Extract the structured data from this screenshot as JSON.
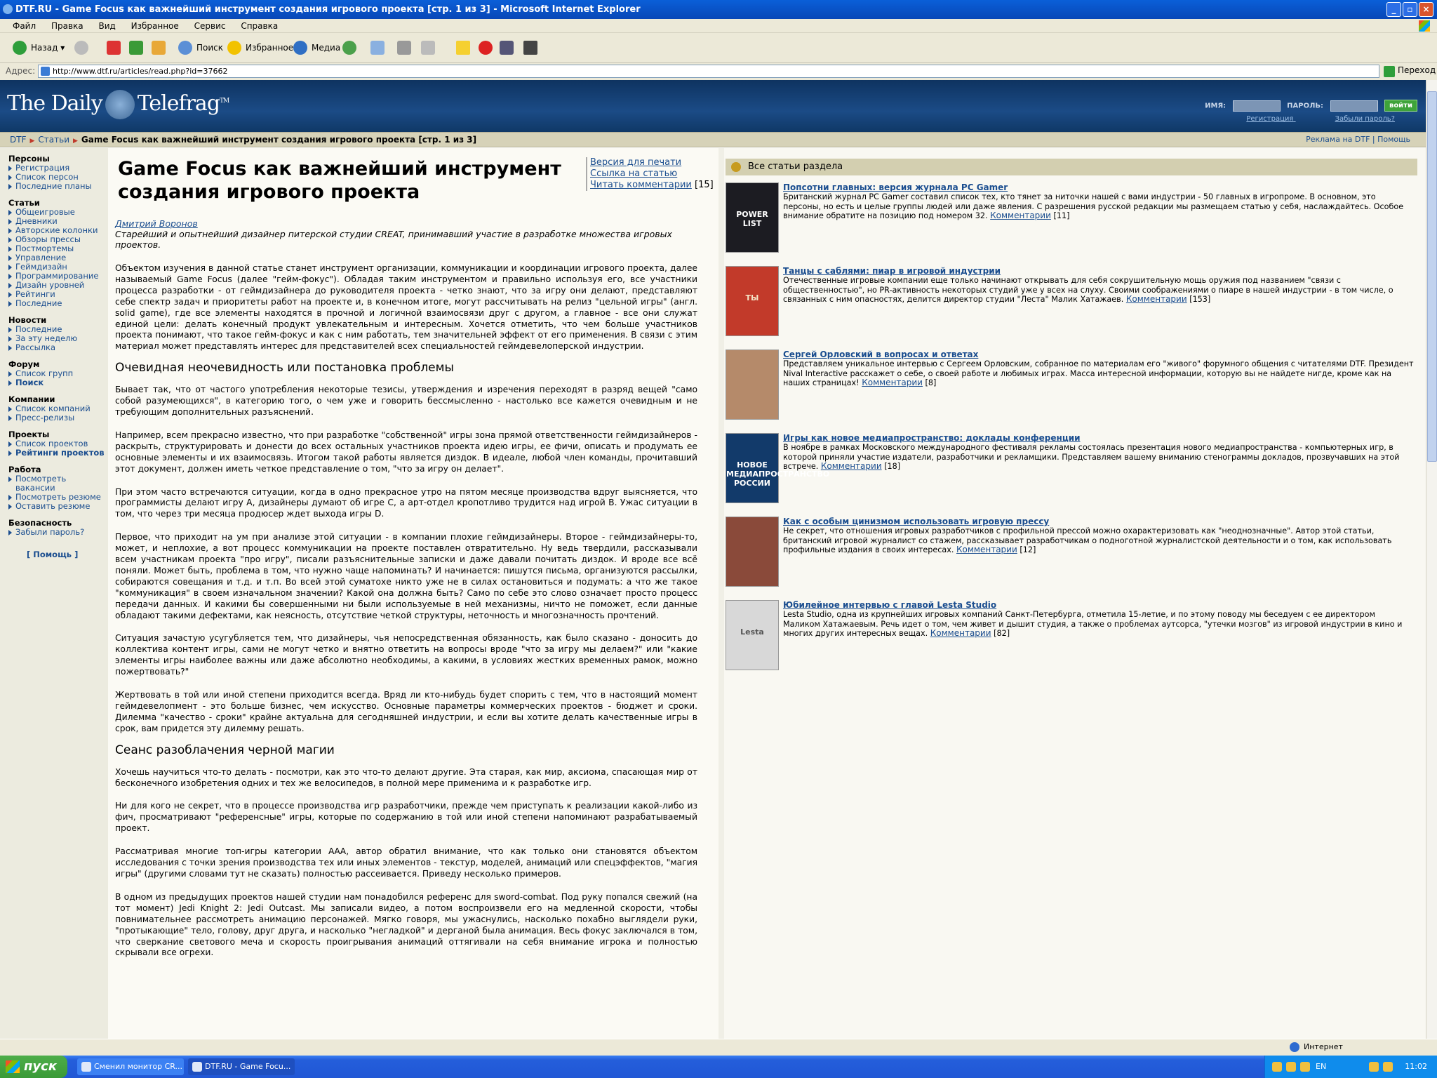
{
  "window": {
    "title": "DTF.RU - Game Focus как важнейший инструмент создания игрового проекта [стр. 1 из 3] - Microsoft Internet Explorer",
    "controls": [
      "_",
      "▫",
      "×"
    ]
  },
  "menu": [
    "Файл",
    "Правка",
    "Вид",
    "Избранное",
    "Сервис",
    "Справка"
  ],
  "toolbar": {
    "back": "Назад",
    "search": "Поиск",
    "favorites": "Избранное",
    "media": "Медиа"
  },
  "address": {
    "label": "Адрес:",
    "url": "http://www.dtf.ru/articles/read.php?id=37662",
    "go": "Переход"
  },
  "site": {
    "logo_left": "The Daily",
    "logo_right": "Telefrag",
    "logo_tm": "TM",
    "login": {
      "name_label": "ИМЯ:",
      "password_label": "ПАРОЛЬ:",
      "submit": "войти",
      "register": "Регистрация",
      "forgot": "Забыли пароль?"
    },
    "breadcrumb": {
      "root": "DTF",
      "section": "Статьи",
      "current": "Game Focus как важнейший инструмент создания игрового проекта [стр. 1 из 3]",
      "ads": "Реклама на DTF",
      "sep": "|",
      "help": "Помощь"
    }
  },
  "leftnav": {
    "sections": [
      {
        "title": "Персоны",
        "items": [
          {
            "label": "Регистрация"
          },
          {
            "label": "Список персон"
          },
          {
            "label": "Последние планы"
          }
        ]
      },
      {
        "title": "Статьи",
        "items": [
          {
            "label": "Общеигровые"
          },
          {
            "label": "Дневники"
          },
          {
            "label": "Авторские колонки"
          },
          {
            "label": "Обзоры прессы"
          },
          {
            "label": "Постмортемы"
          },
          {
            "label": "Управление"
          },
          {
            "label": "Геймдизайн"
          },
          {
            "label": "Программирование"
          },
          {
            "label": "Дизайн уровней"
          },
          {
            "label": "Рейтинги"
          },
          {
            "label": "Последние"
          }
        ]
      },
      {
        "title": "Новости",
        "items": [
          {
            "label": "Последние"
          },
          {
            "label": "За эту неделю"
          },
          {
            "label": "Рассылка"
          }
        ]
      },
      {
        "title": "Форум",
        "items": [
          {
            "label": "Список групп"
          },
          {
            "label": "Поиск",
            "bold": true
          }
        ]
      },
      {
        "title": "Компании",
        "items": [
          {
            "label": "Список компаний"
          },
          {
            "label": "Пресс-релизы"
          }
        ]
      },
      {
        "title": "Проекты",
        "items": [
          {
            "label": "Список проектов"
          },
          {
            "label": "Рейтинги проектов",
            "bold": true
          }
        ]
      },
      {
        "title": "Работа",
        "items": [
          {
            "label": "Посмотреть вакансии"
          },
          {
            "label": "Посмотреть резюме"
          },
          {
            "label": "Оставить резюме"
          }
        ]
      },
      {
        "title": "Безопасность",
        "items": [
          {
            "label": "Забыли пароль?"
          }
        ]
      }
    ],
    "help": "[ Помощь ]"
  },
  "article": {
    "title": "Game Focus как важнейший инструмент создания игрового проекта",
    "links": {
      "print": "Версия для печати",
      "link": "Ссылка на статью",
      "comments": "Читать комментарии",
      "comment_count": "[15]"
    },
    "author": "Дмитрий Воронов",
    "author_bio": "Старейший и опытнейший дизайнер питерской студии CREAT, принимавший участие в разработке множества игровых проектов.",
    "paragraphs": [
      {
        "type": "p",
        "text": "Объектом изучения в данной статье станет инструмент организации, коммуникации и координации игрового проекта, далее называемый Game Focus (далее \"гейм-фокус\"). Обладая таким инструментом и правильно используя его, все участники процесса разработки - от геймдизайнера до руководителя проекта - четко знают, что за игру они делают, представляют себе спектр задач и приоритеты работ на проекте и, в конечном итоге, могут рассчитывать на релиз \"цельной игры\" (англ. solid game), где все элементы находятся в прочной и логичной взаимосвязи друг с другом, а главное - все они служат единой цели: делать конечный продукт увлекательным и интересным. Хочется отметить, что чем больше участников проекта понимают, что такое гейм-фокус и как с ним работать, тем значительней эффект от его применения. В связи с этим материал может представлять интерес для представителей всех специальностей геймдевелоперской индустрии."
      },
      {
        "type": "h",
        "text": "Очевидная неочевидность или постановка проблемы"
      },
      {
        "type": "p",
        "text": "Бывает так, что от частого употребления некоторые тезисы, утверждения и изречения переходят в разряд вещей \"само собой разумеющихся\", в категорию того, о чем уже и говорить бессмысленно - настолько все кажется очевидным и не требующим дополнительных разъяснений."
      },
      {
        "type": "p",
        "text": "Например, всем прекрасно известно, что при разработке \"собственной\" игры зона прямой ответственности геймдизайнеров - раскрыть, структурировать и донести до всех остальных участников проекта идею игры, ее фичи, описать и продумать ее основные элементы и их взаимосвязь. Итогом такой работы является диздок. В идеале, любой член команды, прочитавший этот документ, должен иметь четкое представление о том, \"что за игру он делает\"."
      },
      {
        "type": "p",
        "text": "При этом часто встречаются ситуации, когда в одно прекрасное утро на пятом месяце производства вдруг выясняется, что программисты делают игру A, дизайнеры думают об игре C, а арт-отдел кропотливо трудится над игрой B. Ужас ситуации в том, что через три месяца продюсер ждет выхода игры D."
      },
      {
        "type": "p",
        "text": "Первое, что приходит на ум при анализе этой ситуации - в компании плохие геймдизайнеры. Второе - геймдизайнеры-то, может, и неплохие, а вот процесс коммуникации на проекте поставлен отвратительно. Ну ведь твердили, рассказывали всем участникам проекта \"про игру\", писали разъяснительные записки и даже давали почитать диздок. И вроде все всё поняли. Может быть, проблема в том, что нужно чаще напоминать? И начинается: пишутся письма, организуются рассылки, собираются совещания и т.д. и т.п. Во всей этой суматохе никто уже не в силах остановиться и подумать: а что же такое \"коммуникация\" в своем изначальном значении? Какой она должна быть? Само по себе это слово означает просто процесс передачи данных. И какими бы совершенными ни были используемые в ней механизмы, ничто не поможет, если данные обладают такими дефектами, как неясность, отсутствие четкой структуры, неточность и многозначность прочтений."
      },
      {
        "type": "p",
        "text": "Ситуация зачастую усугубляется тем, что дизайнеры, чья непосредственная обязанность, как было сказано - доносить до коллектива контент игры, сами не могут четко и внятно ответить на вопросы вроде \"что за игру мы делаем?\" или \"какие элементы игры наиболее важны или даже абсолютно необходимы, а какими, в условиях жестких временных рамок, можно пожертвовать?\""
      },
      {
        "type": "p",
        "text": "Жертвовать в той или иной степени приходится всегда. Вряд ли кто-нибудь будет спорить с тем, что в настоящий момент геймдевелопмент - это больше бизнес, чем искусство. Основные параметры коммерческих проектов - бюджет и сроки. Дилемма \"качество - сроки\" крайне актуальна для сегодняшней индустрии, и если вы хотите делать качественные игры в срок, вам придется эту дилемму решать."
      },
      {
        "type": "h",
        "text": "Сеанс разоблачения черной магии"
      },
      {
        "type": "p",
        "text": "Хочешь научиться что-то делать - посмотри, как это что-то делают другие. Эта старая, как мир, аксиома, спасающая мир от бесконечного изобретения одних и тех же велосипедов, в полной мере применима и к разработке игр."
      },
      {
        "type": "p",
        "text": "Ни для кого не секрет, что в процессе производства игр разработчики, прежде чем приступать к реализации какой-либо из фич, просматривают \"референсные\" игры, которые по содержанию в той или иной степени напоминают разрабатываемый проект."
      },
      {
        "type": "p",
        "text": "Рассматривая многие топ-игры категории ААА, автор обратил внимание, что как только они становятся объектом исследования с точки зрения производства тех или иных элементов - текстур, моделей, анимаций или спецэффектов, \"магия игры\" (другими словами тут не сказать) полностью рассеивается. Приведу несколько примеров."
      },
      {
        "type": "p",
        "text": "В одном из предыдущих проектов нашей студии нам понадобился референс для sword-combat. Под руку попался свежий (на тот момент) Jedi Knight 2: Jedi Outcast. Мы записали видео, а потом воспроизвели его на медленной скорости, чтобы повнимательнее рассмотреть анимацию персонажей. Мягко говоря, мы ужаснулись, насколько похабно выглядели руки, \"протыкающие\" тело, голову, друг друга, и насколько \"негладкой\" и дерганой была анимация. Весь фокус заключался в том, что сверкание светового меча и скорость проигрывания анимаций оттягивали на себя внимание игрока и полностью скрывали все огрехи."
      }
    ]
  },
  "sidebar_right": {
    "header": "Все статьи раздела",
    "items": [
      {
        "title": "Попсотни главных: версия журнала PC Gamer",
        "text": "Британский журнал PC Gamer составил список тех, кто тянет за ниточки нашей с вами индустрии - 50 главных в игропроме. В основном, это персоны, но есть и целые группы людей или даже явления. С разрешения русской редакции мы размещаем статью у себя, наслаждайтесь. Особое внимание обратите на позицию под номером 32.",
        "comments": "Комментарии",
        "count": "[11]",
        "thumb_text": "POWER LIST",
        "thumb_bg": "#1c1c22",
        "thumb_fg": "#ffffff"
      },
      {
        "title": "Танцы с саблями: пиар в игровой индустрии",
        "text": "Отечественные игровые компании еще только начинают открывать для себя сокрушительную мощь оружия под названием \"связи с общественностью\", но PR-активность некоторых студий уже у всех на слуху. Своими соображениями о пиаре в нашей индустрии - в том числе, о связанных с ним опасностях, делится директор студии \"Леста\" Малик Хатажаев.",
        "comments": "Комментарии",
        "count": "[153]",
        "thumb_text": "ТЫ",
        "thumb_bg": "#c23a2a",
        "thumb_fg": "#f5e6c8"
      },
      {
        "title": "Сергей Орловский в вопросах и ответах",
        "text": "Представляем уникальное интервью с Сергеем Орловским, собранное по материалам его \"живого\" форумного общения с читателями DTF. Президент Nival Interactive расскажет о себе, о своей работе и любимых играх. Масса интересной информации, которую вы не найдете нигде, кроме как на наших страницах!",
        "comments": "Комментарии",
        "count": "[8]",
        "thumb_text": "",
        "thumb_bg": "#b58a6a",
        "thumb_fg": "#ffffff"
      },
      {
        "title": "Игры как новое медиапространство: доклады конференции",
        "text": "В ноябре в рамках Московского международного фестиваля рекламы состоялась презентация нового медиапространства - компьютерных игр, в которой приняли участие издатели, разработчики и рекламщики. Представляем вашему вниманию стенограммы докладов, прозвучавших на этой встрече.",
        "comments": "Комментарии",
        "count": "[18]",
        "thumb_text": "НОВОЕ МЕДИАПРОСТРАНСТВО РОССИИ",
        "thumb_bg": "#123a6a",
        "thumb_fg": "#ffffff"
      },
      {
        "title": "Как с особым цинизмом использовать игровую прессу",
        "text": "Не секрет, что отношения игровых разработчиков с профильной прессой можно охарактеризовать как \"неоднозначные\". Автор этой статьи, британский игровой журналист со стажем, рассказывает разработчикам о подноготной журналистской деятельности и о том, как использовать профильные издания в своих интересах.",
        "comments": "Комментарии",
        "count": "[12]",
        "thumb_text": "",
        "thumb_bg": "#8a4a3a",
        "thumb_fg": "#ffffff"
      },
      {
        "title": "Юбилейное интервью с главой Lesta Studio",
        "text": "Lesta Studio, одна из крупнейших игровых компаний Санкт-Петербурга, отметила 15-летие, и по этому поводу мы беседуем с ее директором Маликом Хатажаевым. Речь идет о том, чем живет и дышит студия, а также о проблемах аутсорса, \"утечки мозгов\" из игровой индустрии в кино и многих других интересных вещах.",
        "comments": "Комментарии",
        "count": "[82]",
        "thumb_text": "Lesta",
        "thumb_bg": "#d8d8d8",
        "thumb_fg": "#555555"
      }
    ]
  },
  "status": {
    "zone": "Интернет"
  },
  "taskbar": {
    "start": "пуск",
    "tasks": [
      {
        "label": "Сменил монитор CR..."
      },
      {
        "label": "DTF.RU - Game Focu..."
      }
    ],
    "lang": "EN",
    "clock": "11:02"
  }
}
